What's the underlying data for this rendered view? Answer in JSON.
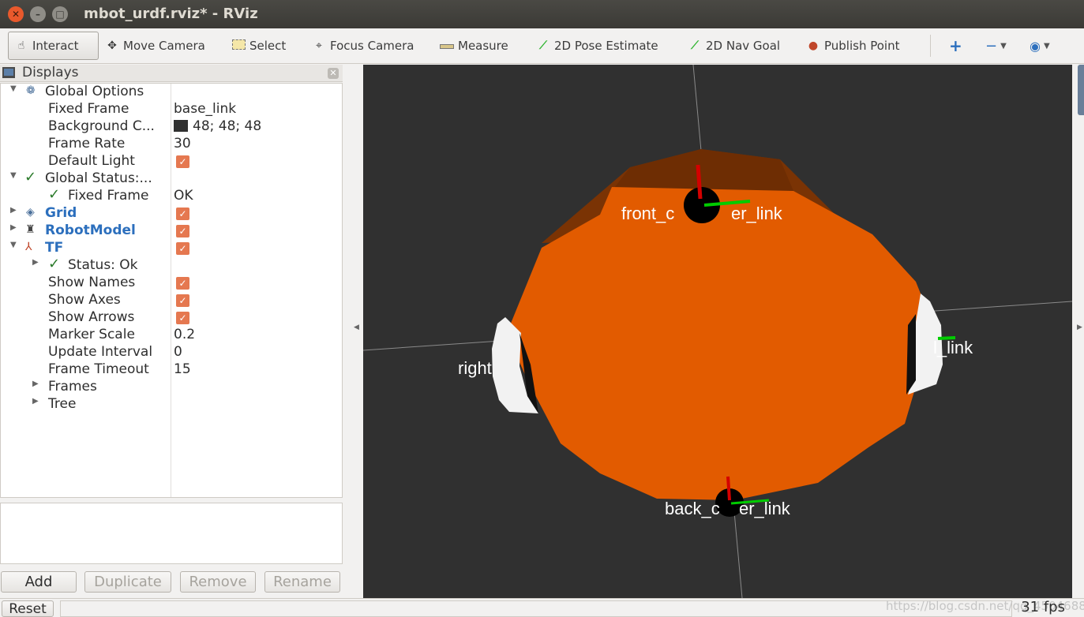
{
  "window": {
    "title": "mbot_urdf.rviz* - RViz"
  },
  "toolbar": {
    "interact": "Interact",
    "move_camera": "Move Camera",
    "select": "Select",
    "focus_camera": "Focus Camera",
    "measure": "Measure",
    "pose_estimate": "2D Pose Estimate",
    "nav_goal": "2D Nav Goal",
    "publish_point": "Publish Point"
  },
  "displays": {
    "title": "Displays",
    "rows": {
      "global_options": "Global Options",
      "fixed_frame_label": "Fixed Frame",
      "fixed_frame_value": "base_link",
      "bg_label": "Background C...",
      "bg_value": "48; 48; 48",
      "frame_rate_label": "Frame Rate",
      "frame_rate_value": "30",
      "default_light_label": "Default Light",
      "global_status_label": "Global Status:...",
      "status_fixed_frame_label": "Fixed Frame",
      "status_fixed_frame_value": "OK",
      "grid": "Grid",
      "robot_model": "RobotModel",
      "tf": "TF",
      "tf_status": "Status: Ok",
      "show_names": "Show Names",
      "show_axes": "Show Axes",
      "show_arrows": "Show Arrows",
      "marker_scale_label": "Marker Scale",
      "marker_scale_value": "0.2",
      "update_interval_label": "Update Interval",
      "update_interval_value": "0",
      "frame_timeout_label": "Frame Timeout",
      "frame_timeout_value": "15",
      "frames": "Frames",
      "tree": "Tree"
    },
    "buttons": {
      "add": "Add",
      "duplicate": "Duplicate",
      "remove": "Remove",
      "rename": "Rename"
    }
  },
  "viewport": {
    "background_color": "#303030",
    "labels": {
      "front": "front_c",
      "front_tail": "er_link",
      "right": "right",
      "left": "l_link",
      "back": "back_c",
      "back_tail": "er_link"
    }
  },
  "status": {
    "reset": "Reset",
    "fps": "31 fps",
    "watermark": "https://blog.csdn.net/qq_45046881"
  }
}
